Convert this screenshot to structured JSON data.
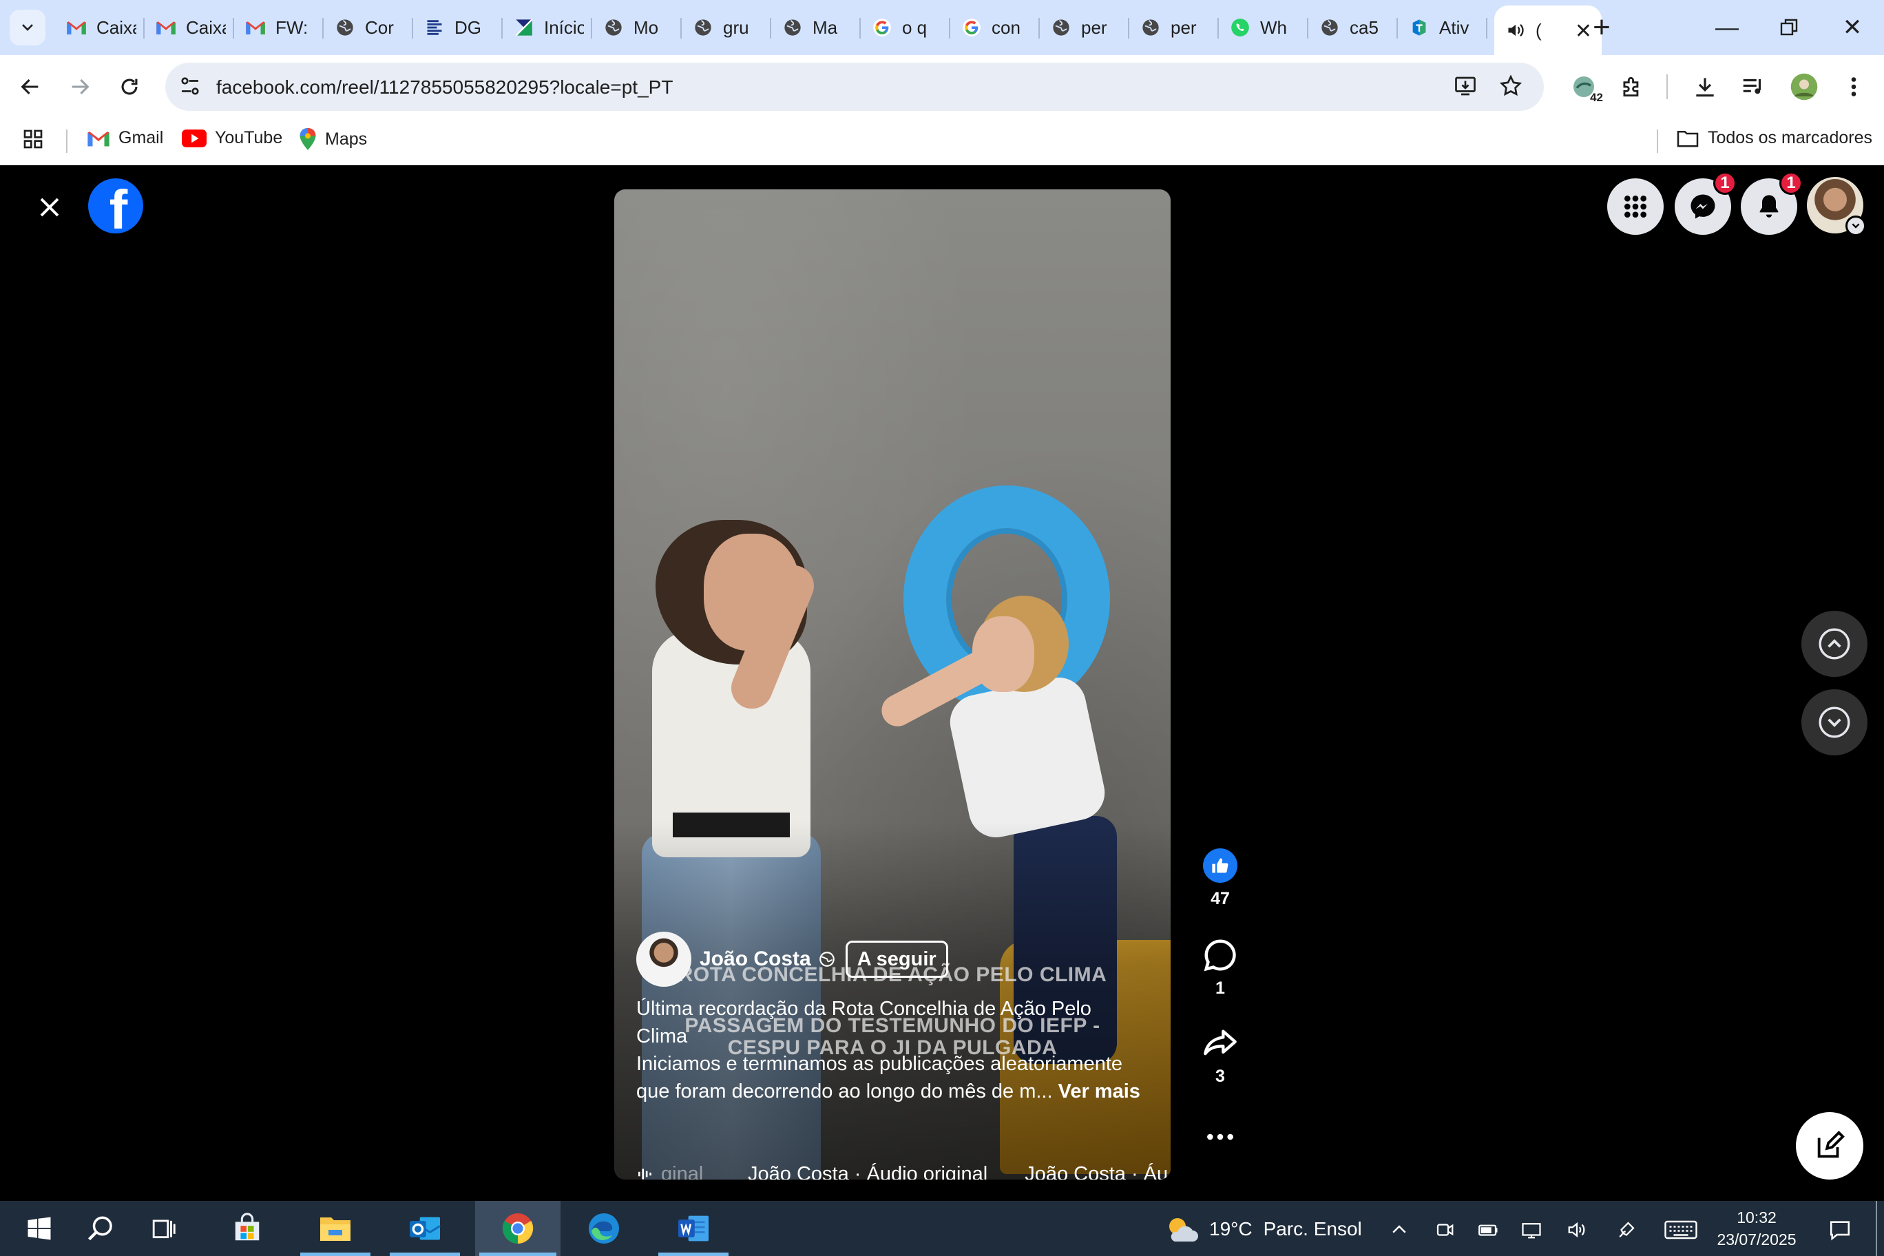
{
  "browser": {
    "tabs": [
      {
        "title": "Caixa de entrada",
        "icon": "gmail-icon"
      },
      {
        "title": "Caixa de entrada",
        "icon": "gmail-icon"
      },
      {
        "title": "FW:",
        "icon": "gmail-icon"
      },
      {
        "title": "Cor",
        "icon": "globe-icon"
      },
      {
        "title": "DG",
        "icon": "dge-icon"
      },
      {
        "title": "Início",
        "icon": "flag-icon"
      },
      {
        "title": "Mo",
        "icon": "globe-icon"
      },
      {
        "title": "gru",
        "icon": "globe-icon"
      },
      {
        "title": "Ma",
        "icon": "globe-icon"
      },
      {
        "title": "o q",
        "icon": "google-icon"
      },
      {
        "title": "con",
        "icon": "google-icon"
      },
      {
        "title": "per",
        "icon": "globe-icon"
      },
      {
        "title": "per",
        "icon": "globe-icon"
      },
      {
        "title": "Wh",
        "icon": "whatsapp-icon"
      },
      {
        "title": "ca5",
        "icon": "globe-icon"
      },
      {
        "title": "Ativ",
        "icon": "teams-icon"
      }
    ],
    "active_tab_title": "(",
    "url": "facebook.com/reel/1127855055820295?locale=pt_PT",
    "extension_badge": "42",
    "bookmarks": [
      {
        "label": "Gmail"
      },
      {
        "label": "YouTube"
      },
      {
        "label": "Maps"
      }
    ],
    "all_bookmarks_label": "Todos os marcadores"
  },
  "facebook": {
    "messenger_badge": "1",
    "notifications_badge": "1",
    "reel": {
      "overlay_line1": "ROTA CONCELHIA DE AÇÃO PELO CLIMA",
      "overlay_line2": "PASSAGEM DO TESTEMUNHO DO IEFP -",
      "overlay_line3": "CESPU PARA O JI DA PULGADA",
      "author": "João Costa",
      "follow_label": "A seguir",
      "caption_line1": "Última recordação da Rota Concelhia de Ação Pelo Clima",
      "caption_line2": "Iniciamos e terminamos as publicações aleatoriamente que foram decorrendo ao longo do mês de m...",
      "see_more": "Ver mais",
      "audio_prefix": "ginal",
      "audio_1": "João Costa · Áudio original",
      "audio_2": "João Costa · Áu",
      "likes": "47",
      "comments": "1",
      "shares": "3"
    }
  },
  "taskbar": {
    "weather_temp": "19°C",
    "weather_desc": "Parc. Ensol",
    "time": "10:32",
    "date": "23/07/2025"
  },
  "colors": {
    "facebook_blue": "#0866ff",
    "like_blue": "#1877f2",
    "badge_red": "#e41e3f",
    "tire_blue": "#3aa4e0"
  }
}
